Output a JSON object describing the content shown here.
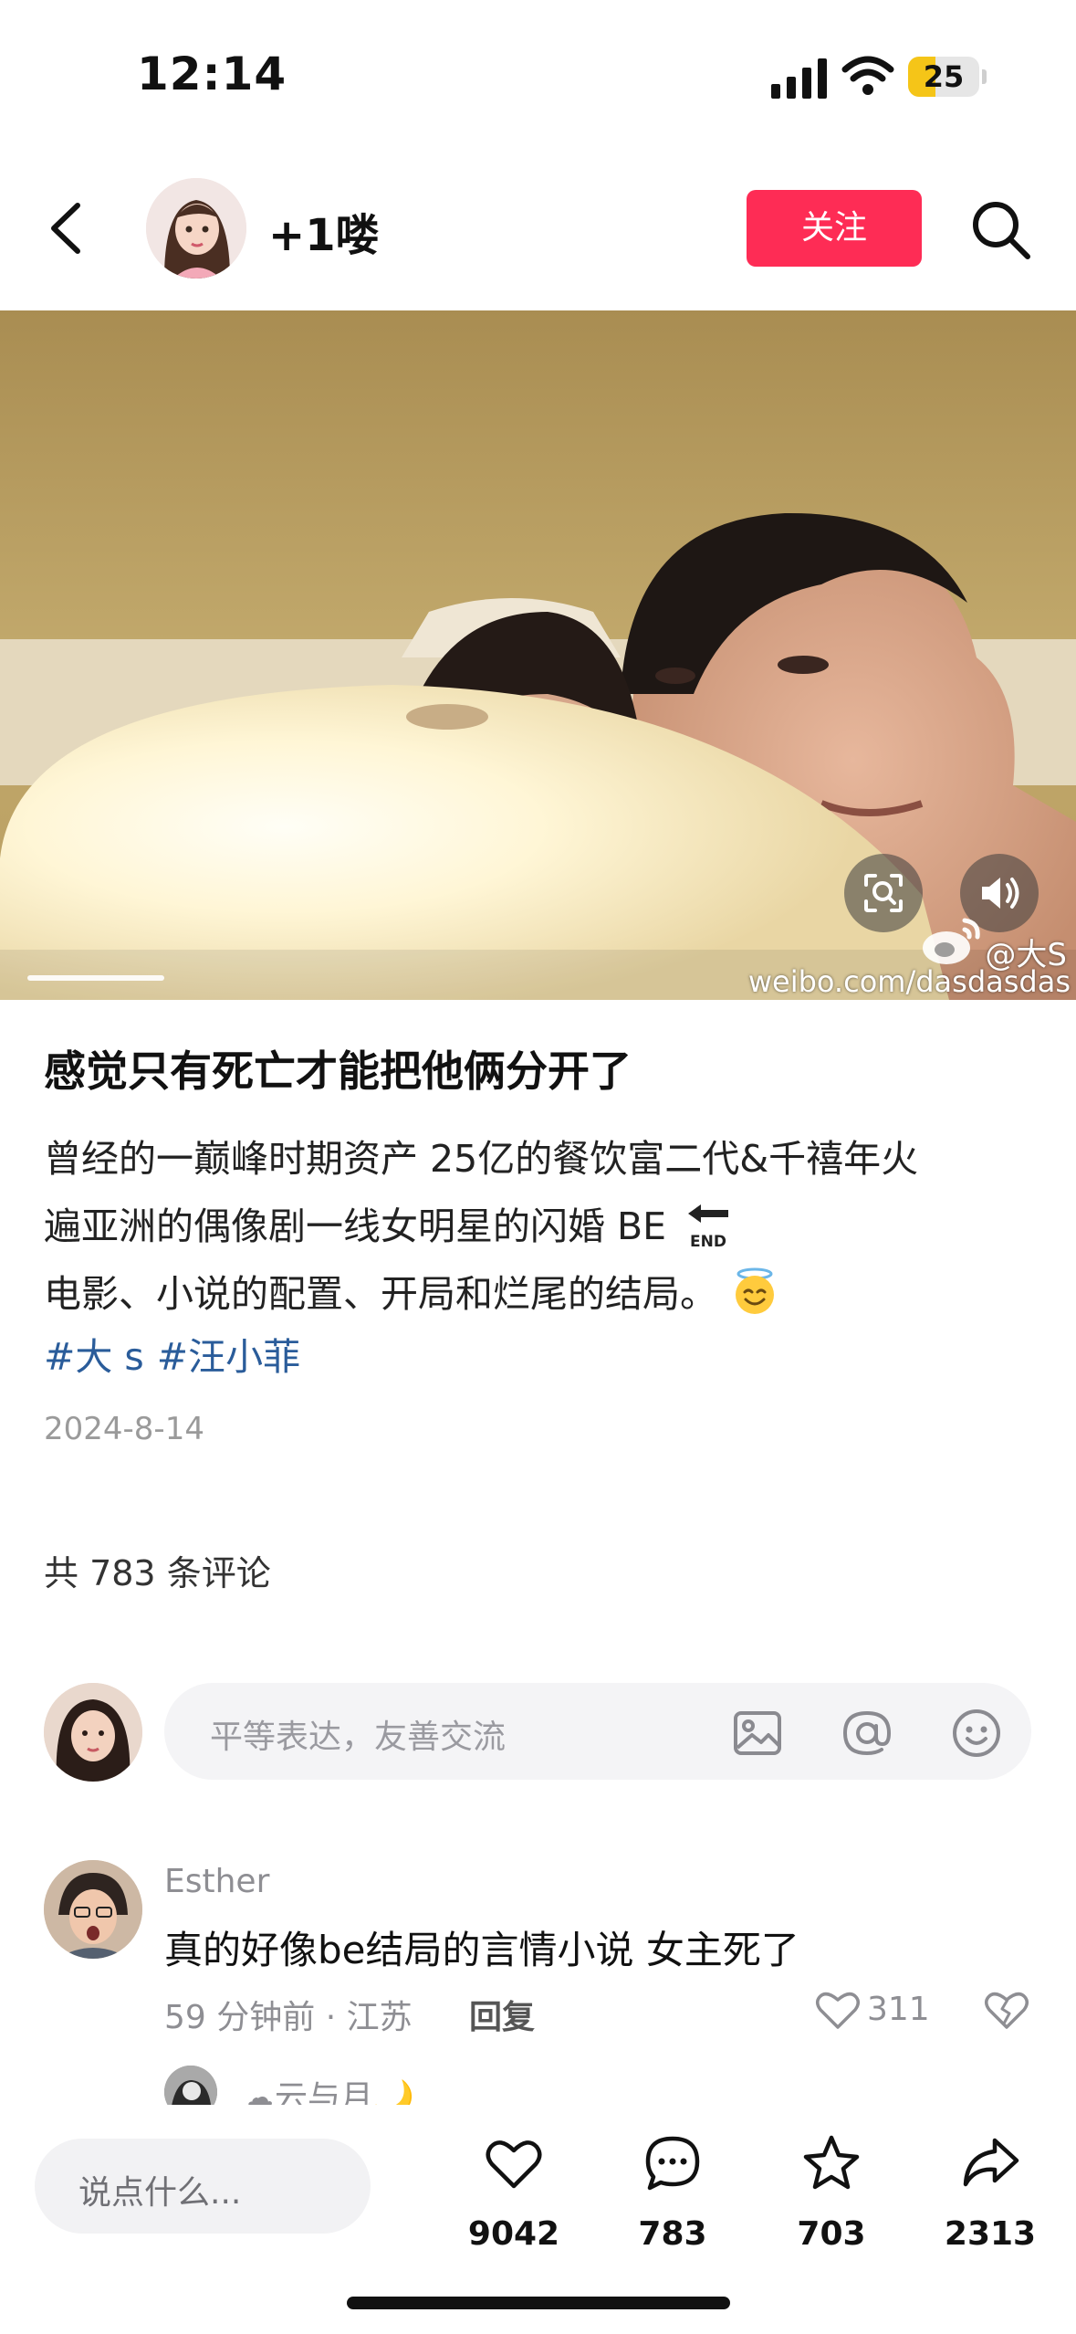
{
  "status_bar": {
    "time": "12:14",
    "battery": "25"
  },
  "header": {
    "author_name": "+1喽",
    "follow_label": "关注"
  },
  "media": {
    "watermark_handle": "@大S",
    "watermark_site": "weibo.com/dasdasdas"
  },
  "post": {
    "title": "感觉只有死亡才能把他俩分开了",
    "body_lines": [
      "曾经的一巅峰时期资产 25亿的餐饮富二代&千禧年火",
      "遍亚洲的偶像剧一线女明星的闪婚 BE",
      "电影、小说的配置、开局和烂尾的结局。"
    ],
    "end_badge": "END",
    "tags": [
      "#大 s",
      "#汪小菲"
    ],
    "date": "2024-8-14"
  },
  "comments": {
    "count_label": "共 783 条评论",
    "input_placeholder": "平等表达，友善交流",
    "items": [
      {
        "user": "Esther",
        "text": "真的好像be结局的言情小说 女主死了",
        "meta": "59 分钟前 · 江苏",
        "reply_label": "回复",
        "likes": "311"
      }
    ],
    "reply_peek_name": "☁云与月🌙"
  },
  "bottom_bar": {
    "say_placeholder": "说点什么...",
    "likes": "9042",
    "comments": "783",
    "favorites": "703",
    "shares": "2313"
  },
  "colors": {
    "follow": "#fe2c55",
    "tag": "#2a5c9a",
    "battery": "#f5c518"
  },
  "icons": [
    "back-arrow-icon",
    "search-icon",
    "lens-icon",
    "sound-icon",
    "image-icon",
    "at-icon",
    "emoji-icon",
    "heart-icon",
    "broken-heart-icon",
    "comment-icon",
    "star-icon",
    "share-icon"
  ]
}
